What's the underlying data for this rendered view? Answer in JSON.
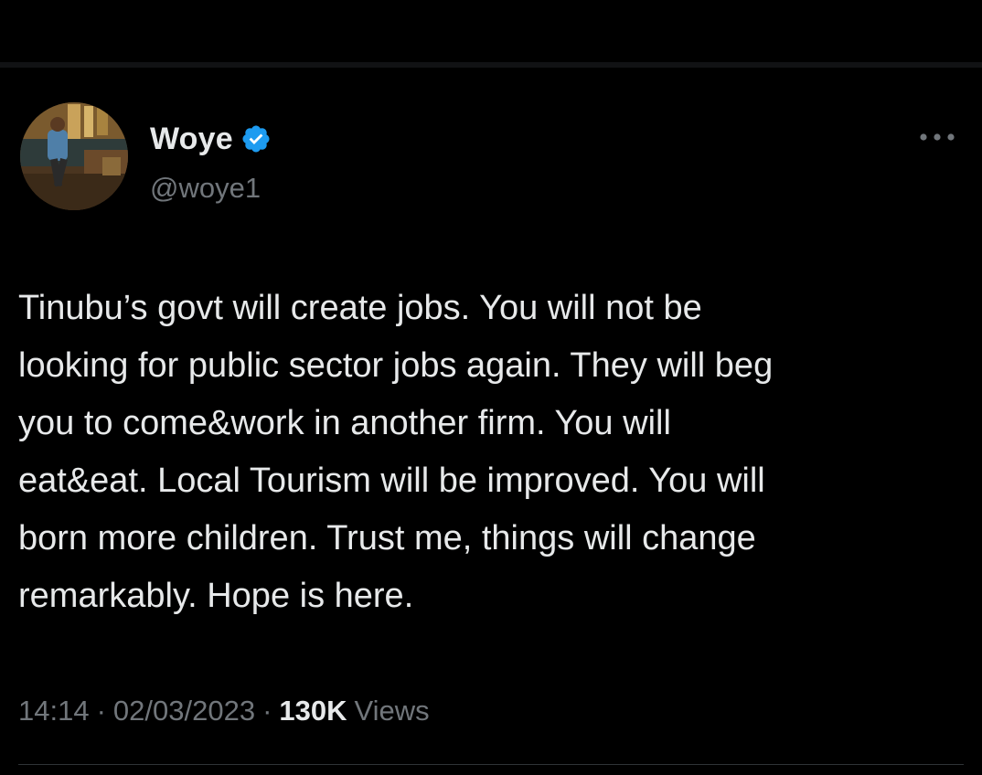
{
  "tweet": {
    "author": {
      "display_name": "Woye",
      "handle": "@woye1",
      "verified": true,
      "verified_icon": "verified-badge-icon",
      "verified_color": "#1d9bf0"
    },
    "text": "Tinubu’s govt will create jobs. You will not be\nlooking for public sector jobs again. They will beg\nyou to come&work in another firm. You will\neat&eat. Local Tourism will be improved. You will\nborn more children. Trust me, things will change\nremarkably. Hope is here.",
    "time": "14:14",
    "separator": "·",
    "date": "02/03/2023",
    "views_count": "130K",
    "views_label": "Views"
  },
  "icons": {
    "more": "more-horizontal-icon"
  },
  "colors": {
    "background": "#000000",
    "primary_text": "#e7e9ea",
    "secondary_text": "#71767b",
    "accent": "#1d9bf0"
  }
}
